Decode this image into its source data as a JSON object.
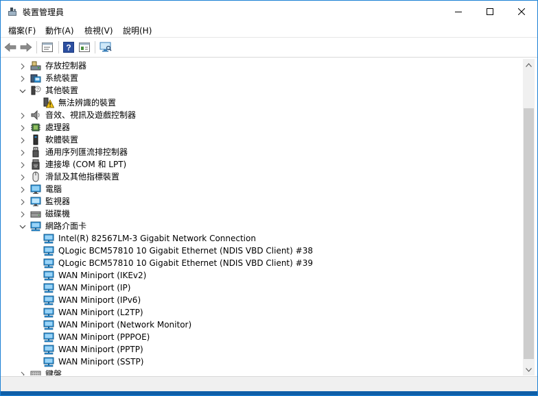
{
  "window": {
    "title": "裝置管理員"
  },
  "menu": {
    "items": [
      "檔案(F)",
      "動作(A)",
      "檢視(V)",
      "說明(H)"
    ]
  },
  "toolbar": {
    "buttons": [
      "back-icon",
      "forward-icon",
      "properties-icon",
      "help-icon",
      "view-icon",
      "monitor-scan-icon"
    ]
  },
  "tree": {
    "items": [
      {
        "label": "存放控制器",
        "level": 0,
        "state": "collapsed",
        "icon": "storage-controller-icon"
      },
      {
        "label": "系統裝置",
        "level": 0,
        "state": "collapsed",
        "icon": "system-device-icon"
      },
      {
        "label": "其他裝置",
        "level": 0,
        "state": "expanded",
        "icon": "other-device-icon"
      },
      {
        "label": "無法辨識的裝置",
        "level": 1,
        "state": "leaf",
        "icon": "unknown-device-warning-icon"
      },
      {
        "label": "音效、視訊及遊戲控制器",
        "level": 0,
        "state": "collapsed",
        "icon": "speaker-icon"
      },
      {
        "label": "處理器",
        "level": 0,
        "state": "collapsed",
        "icon": "processor-icon"
      },
      {
        "label": "軟體裝置",
        "level": 0,
        "state": "collapsed",
        "icon": "software-device-icon"
      },
      {
        "label": "通用序列匯流排控制器",
        "level": 0,
        "state": "collapsed",
        "icon": "usb-icon"
      },
      {
        "label": "連接埠 (COM 和 LPT)",
        "level": 0,
        "state": "collapsed",
        "icon": "port-icon"
      },
      {
        "label": "滑鼠及其他指標裝置",
        "level": 0,
        "state": "collapsed",
        "icon": "mouse-icon"
      },
      {
        "label": "電腦",
        "level": 0,
        "state": "collapsed",
        "icon": "computer-icon"
      },
      {
        "label": "監視器",
        "level": 0,
        "state": "collapsed",
        "icon": "monitor-icon"
      },
      {
        "label": "磁碟機",
        "level": 0,
        "state": "collapsed",
        "icon": "disk-drive-icon"
      },
      {
        "label": "網路介面卡",
        "level": 0,
        "state": "expanded",
        "icon": "network-adapter-icon"
      },
      {
        "label": "Intel(R) 82567LM-3 Gigabit Network Connection",
        "level": 1,
        "state": "leaf",
        "icon": "network-adapter-icon"
      },
      {
        "label": "QLogic BCM57810 10 Gigabit Ethernet (NDIS VBD Client) #38",
        "level": 1,
        "state": "leaf",
        "icon": "network-adapter-icon"
      },
      {
        "label": "QLogic BCM57810 10 Gigabit Ethernet (NDIS VBD Client) #39",
        "level": 1,
        "state": "leaf",
        "icon": "network-adapter-icon"
      },
      {
        "label": "WAN Miniport (IKEv2)",
        "level": 1,
        "state": "leaf",
        "icon": "network-adapter-icon"
      },
      {
        "label": "WAN Miniport (IP)",
        "level": 1,
        "state": "leaf",
        "icon": "network-adapter-icon"
      },
      {
        "label": "WAN Miniport (IPv6)",
        "level": 1,
        "state": "leaf",
        "icon": "network-adapter-icon"
      },
      {
        "label": "WAN Miniport (L2TP)",
        "level": 1,
        "state": "leaf",
        "icon": "network-adapter-icon"
      },
      {
        "label": "WAN Miniport (Network Monitor)",
        "level": 1,
        "state": "leaf",
        "icon": "network-adapter-icon"
      },
      {
        "label": "WAN Miniport (PPPOE)",
        "level": 1,
        "state": "leaf",
        "icon": "network-adapter-icon"
      },
      {
        "label": "WAN Miniport (PPTP)",
        "level": 1,
        "state": "leaf",
        "icon": "network-adapter-icon"
      },
      {
        "label": "WAN Miniport (SSTP)",
        "level": 1,
        "state": "leaf",
        "icon": "network-adapter-icon"
      },
      {
        "label": "鍵盤",
        "level": 0,
        "state": "collapsed",
        "icon": "keyboard-icon"
      }
    ]
  },
  "colors": {
    "accent": "#0f5fa8",
    "selection": "#cce8ff",
    "network_icon": "#2a8fd6"
  }
}
